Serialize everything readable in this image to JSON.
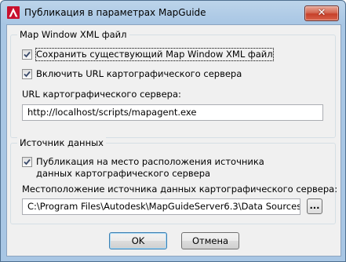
{
  "window": {
    "title": "Публикация в параметрах MapGuide"
  },
  "groups": {
    "xml": {
      "title": "Map Window XML файл",
      "save_existing_label": "Сохранить существующий Map Window XML файл",
      "include_url_label": "Включить URL картографического сервера",
      "url_label": "URL картографического сервера:",
      "url_value": "http://localhost/scripts/mapagent.exe"
    },
    "datasource": {
      "title": "Источник данных",
      "publish_label": "Публикация на место расположения источника данных картографического сервера",
      "location_label": "Местоположение источника данных картографического сервера:",
      "location_value": "C:\\Program Files\\Autodesk\\MapGuideServer6.3\\Data Sources",
      "browse_label": "..."
    }
  },
  "buttons": {
    "ok": "OK",
    "cancel": "Отмена"
  },
  "icons": {
    "app": "autocad-icon",
    "close": "close-icon"
  }
}
